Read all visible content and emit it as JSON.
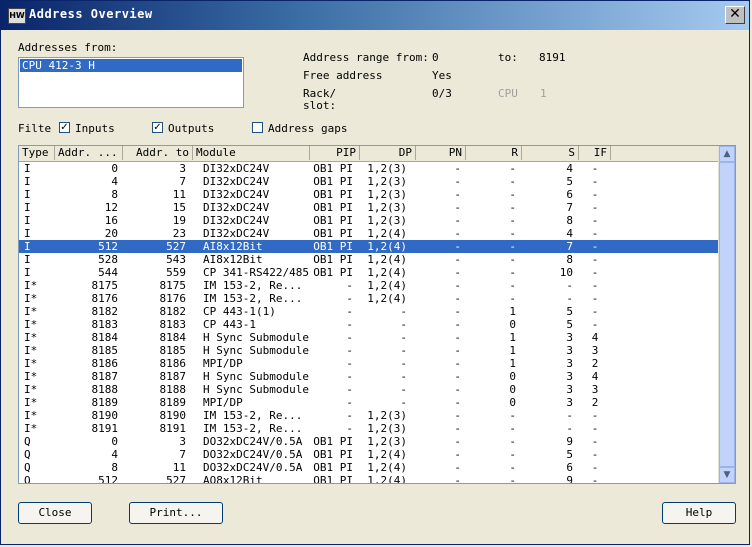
{
  "window": {
    "title": "Address Overview",
    "app_icon": "HW"
  },
  "addresses_from": {
    "label": "Addresses from:",
    "items": [
      "CPU 412-3 H"
    ]
  },
  "info": {
    "range_label": "Address range from:",
    "range_from": "0",
    "to_label": "to:",
    "range_to": "8191",
    "free_label": "Free address",
    "free_value": "Yes",
    "rack_label": "Rack/",
    "slot_label": "slot:",
    "rack_value": "0/3",
    "cpu_label": "CPU",
    "cpu_value": "1"
  },
  "filter": {
    "label": "Filte",
    "inputs": {
      "label": "Inputs",
      "checked": true
    },
    "outputs": {
      "label": "Outputs",
      "checked": true
    },
    "gaps": {
      "label": "Address gaps",
      "checked": false
    }
  },
  "table": {
    "columns": [
      "Type",
      "Addr. ...",
      "Addr. to",
      "Module",
      "PIP",
      "DP",
      "PN",
      "R",
      "S",
      "IF"
    ],
    "selected_index": 6,
    "rows": [
      [
        "I",
        "0",
        "3",
        "DI32xDC24V",
        "OB1 PI",
        "1,2(3)",
        "-",
        "-",
        "4",
        "-"
      ],
      [
        "I",
        "4",
        "7",
        "DI32xDC24V",
        "OB1 PI",
        "1,2(3)",
        "-",
        "-",
        "5",
        "-"
      ],
      [
        "I",
        "8",
        "11",
        "DI32xDC24V",
        "OB1 PI",
        "1,2(3)",
        "-",
        "-",
        "6",
        "-"
      ],
      [
        "I",
        "12",
        "15",
        "DI32xDC24V",
        "OB1 PI",
        "1,2(3)",
        "-",
        "-",
        "7",
        "-"
      ],
      [
        "I",
        "16",
        "19",
        "DI32xDC24V",
        "OB1 PI",
        "1,2(3)",
        "-",
        "-",
        "8",
        "-"
      ],
      [
        "I",
        "20",
        "23",
        "DI32xDC24V",
        "OB1 PI",
        "1,2(4)",
        "-",
        "-",
        "4",
        "-"
      ],
      [
        "I",
        "512",
        "527",
        "AI8x12Bit",
        "OB1 PI",
        "1,2(4)",
        "-",
        "-",
        "7",
        "-"
      ],
      [
        "I",
        "528",
        "543",
        "AI8x12Bit",
        "OB1 PI",
        "1,2(4)",
        "-",
        "-",
        "8",
        "-"
      ],
      [
        "I",
        "544",
        "559",
        "CP 341-RS422/485",
        "OB1 PI",
        "1,2(4)",
        "-",
        "-",
        "10",
        "-"
      ],
      [
        "I*",
        "8175",
        "8175",
        "IM 153-2, Re...",
        "-",
        "1,2(4)",
        "-",
        "-",
        "-",
        "-"
      ],
      [
        "I*",
        "8176",
        "8176",
        "IM 153-2, Re...",
        "-",
        "1,2(4)",
        "-",
        "-",
        "-",
        "-"
      ],
      [
        "I*",
        "8182",
        "8182",
        "CP 443-1(1)",
        "-",
        "-",
        "-",
        "1",
        "5",
        "-"
      ],
      [
        "I*",
        "8183",
        "8183",
        "CP 443-1",
        "-",
        "-",
        "-",
        "0",
        "5",
        "-"
      ],
      [
        "I*",
        "8184",
        "8184",
        "H Sync Submodule",
        "-",
        "-",
        "-",
        "1",
        "3",
        "4"
      ],
      [
        "I*",
        "8185",
        "8185",
        "H Sync Submodule",
        "-",
        "-",
        "-",
        "1",
        "3",
        "3"
      ],
      [
        "I*",
        "8186",
        "8186",
        "MPI/DP",
        "-",
        "-",
        "-",
        "1",
        "3",
        "2"
      ],
      [
        "I*",
        "8187",
        "8187",
        "H Sync Submodule",
        "-",
        "-",
        "-",
        "0",
        "3",
        "4"
      ],
      [
        "I*",
        "8188",
        "8188",
        "H Sync Submodule",
        "-",
        "-",
        "-",
        "0",
        "3",
        "3"
      ],
      [
        "I*",
        "8189",
        "8189",
        "MPI/DP",
        "-",
        "-",
        "-",
        "0",
        "3",
        "2"
      ],
      [
        "I*",
        "8190",
        "8190",
        "IM 153-2, Re...",
        "-",
        "1,2(3)",
        "-",
        "-",
        "-",
        "-"
      ],
      [
        "I*",
        "8191",
        "8191",
        "IM 153-2, Re...",
        "-",
        "1,2(3)",
        "-",
        "-",
        "-",
        "-"
      ],
      [
        "Q",
        "0",
        "3",
        "DO32xDC24V/0.5A",
        "OB1 PI",
        "1,2(3)",
        "-",
        "-",
        "9",
        "-"
      ],
      [
        "Q",
        "4",
        "7",
        "DO32xDC24V/0.5A",
        "OB1 PI",
        "1,2(4)",
        "-",
        "-",
        "5",
        "-"
      ],
      [
        "Q",
        "8",
        "11",
        "DO32xDC24V/0.5A",
        "OB1 PI",
        "1,2(4)",
        "-",
        "-",
        "6",
        "-"
      ],
      [
        "Q",
        "512",
        "527",
        "AO8x12Bit",
        "OB1 PI",
        "1,2(4)",
        "-",
        "-",
        "9",
        "-"
      ]
    ]
  },
  "buttons": {
    "close": "Close",
    "print": "Print...",
    "help": "Help"
  },
  "colors": {
    "selection": "#316ac5",
    "title_start": "#0a246a",
    "title_end": "#a6caf0"
  }
}
